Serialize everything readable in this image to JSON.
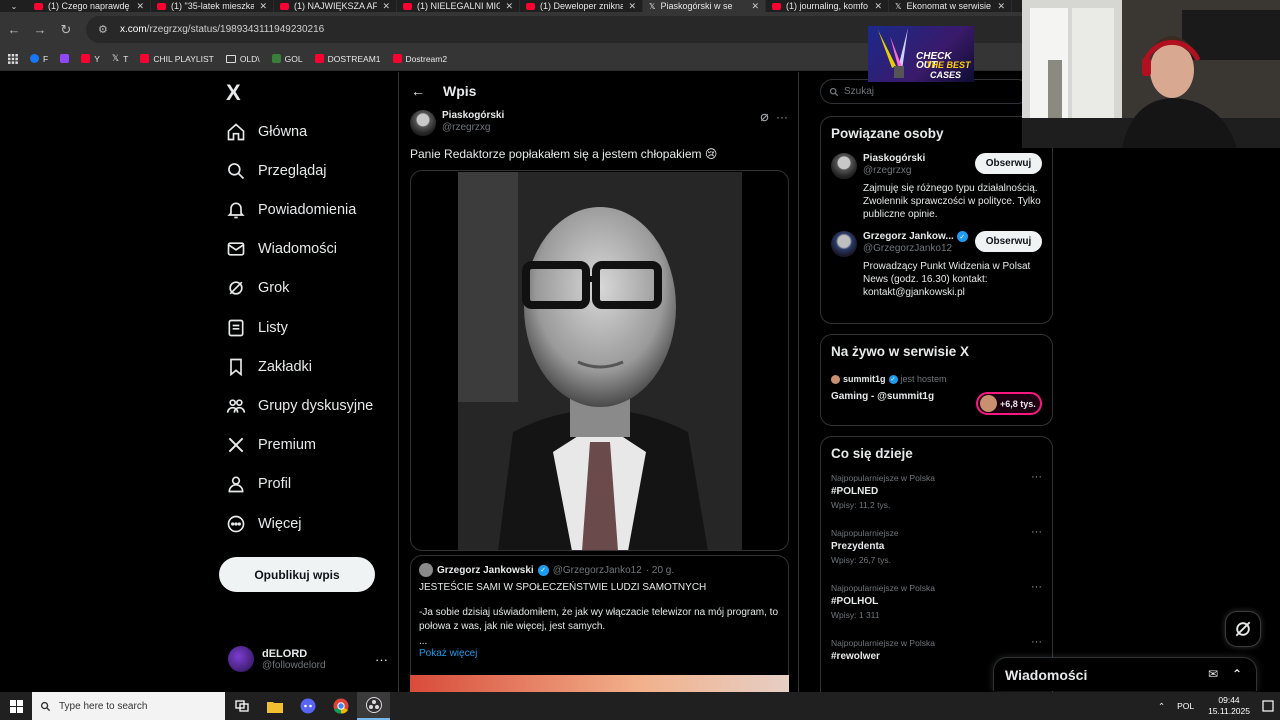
{
  "browser": {
    "tabs": [
      {
        "label": "(1) Czego naprawdę",
        "type": "youtube"
      },
      {
        "label": "(1) \"35-latek mieszka",
        "type": "youtube"
      },
      {
        "label": "(1) NAJWIĘKSZA AFE",
        "type": "youtube"
      },
      {
        "label": "(1) NIELEGALNI MIGR",
        "type": "youtube"
      },
      {
        "label": "(1) Deweloper zniknął",
        "type": "youtube"
      },
      {
        "label": "Piaskogórski w se",
        "type": "x",
        "active": true
      },
      {
        "label": "(1) journaling, komfo",
        "type": "youtube"
      },
      {
        "label": "Ekonomat w serwisie",
        "type": "x"
      }
    ],
    "url_host": "x.com",
    "url_path": "/rzegrzxg/status/1989343111949230216",
    "bookmarks": [
      "F",
      "",
      "Y",
      "T",
      "CHIL PLAYLIST",
      "OLD\\",
      "GOL",
      "DOSTREAM1",
      "Dostream2"
    ]
  },
  "nav": {
    "logo": "X",
    "items": [
      {
        "label": "Główna",
        "icon": "home-icon"
      },
      {
        "label": "Przeglądaj",
        "icon": "search-icon"
      },
      {
        "label": "Powiadomienia",
        "icon": "bell-icon"
      },
      {
        "label": "Wiadomości",
        "icon": "mail-icon"
      },
      {
        "label": "Grok",
        "icon": "grok-icon"
      },
      {
        "label": "Listy",
        "icon": "list-icon"
      },
      {
        "label": "Zakładki",
        "icon": "bookmark-icon"
      },
      {
        "label": "Grupy dyskusyjne",
        "icon": "communities-icon"
      },
      {
        "label": "Premium",
        "icon": "x-premium-icon"
      },
      {
        "label": "Profil",
        "icon": "profile-icon"
      },
      {
        "label": "Więcej",
        "icon": "more-circle-icon"
      }
    ],
    "post_button": "Opublikuj wpis",
    "account_name": "dELORD",
    "account_handle": "@followdelord"
  },
  "main": {
    "header": "Wpis",
    "author_name": "Piaskogórski",
    "author_handle": "@rzegrzxg",
    "tweet_text": "Panie Redaktorze popłakałem się a jestem chłopakiem 😢",
    "quote": {
      "name": "Grzegorz Jankowski",
      "handle": "@GrzegorzJanko12",
      "time": "· 20 g.",
      "line1": "JESTEŚCIE SAMI W SPOŁECZEŃSTWIE LUDZI SAMOTNYCH",
      "line2": "-Ja sobie dzisiaj uświadomiłem, że jak wy włączacie telewizor na mój program, to połowa z was, jak nie więcej, jest samych.",
      "line3": "...",
      "show_more": "Pokaż więcej"
    }
  },
  "right": {
    "search_placeholder": "Szukaj",
    "related_title": "Powiązane osoby",
    "people": [
      {
        "name": "Piaskogórski",
        "handle": "@rzegrzxg",
        "bio": "Zajmuję się różnego typu działalnością. Zwolennik sprawczości w polityce. Tylko publiczne opinie.",
        "follow": "Obserwuj"
      },
      {
        "name": "Grzegorz Jankow...",
        "handle": "@GrzegorzJanko12",
        "bio": "Prowadzący Punkt Widzenia w Polsat News (godz. 16.30) kontakt: kontakt@gjankowski.pl",
        "follow": "Obserwuj"
      }
    ],
    "live_title": "Na żywo w serwisie X",
    "live_host": "summit1g",
    "live_host_text": "jest hostem",
    "live_stream_title": "Gaming - @summit1g",
    "live_count": "+6,8 tys.",
    "trends_title": "Co się dzieje",
    "trends": [
      {
        "category": "Najpopularniejsze w Polska",
        "name": "#POLNED",
        "count": "Wpisy: 11,2 tys."
      },
      {
        "category": "Najpopularniejsze",
        "name": "Prezydenta",
        "count": "Wpisy: 26,7 tys."
      },
      {
        "category": "Najpopularniejsze w Polska",
        "name": "#POLHOL",
        "count": "Wpisy: 1 311"
      },
      {
        "category": "Najpopularniejsze w Polska",
        "name": "#rewolwer",
        "count": ""
      }
    ],
    "messages_drawer": "Wiadomości"
  },
  "overlay": {
    "ad_line1": "CHECK OUT",
    "ad_line2": "THE BEST",
    "ad_line3": "CASES"
  },
  "taskbar": {
    "search_placeholder": "Type here to search",
    "language": "POL",
    "time": "09:44",
    "date": "15.11.2025"
  }
}
